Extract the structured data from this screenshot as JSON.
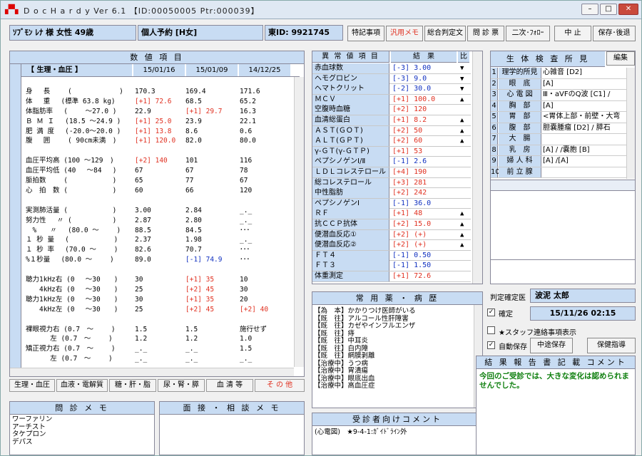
{
  "window": {
    "title": "D o c H a r d y  Ver 6.1  【ID:00050005 Ptr:000039】",
    "min": "–",
    "max": "□",
    "close": "✕"
  },
  "header": {
    "patient": "ｿﾌﾞﾓﾝ ﾚﾅ 様  女性  49歳",
    "reservation": "個人予約 [H女]",
    "id": "東ID: 9921745"
  },
  "toolbar": {
    "special": "特記事項",
    "memo": "汎用メモ",
    "summary": "総合判定文",
    "questionnaire": "問 診 票",
    "followup": "二次･ﾌｫﾛｰ",
    "stop": "中 止",
    "save_back": "保存･後退"
  },
  "values": {
    "title": "数 値 項 目",
    "group": "【 生理・血圧 】",
    "dates": [
      "15/01/16",
      "15/01/09",
      "14/12/25"
    ],
    "rows": [
      {
        "label": "",
        "c1": "",
        "c2": "",
        "c3": ""
      },
      {
        "label": "身　 長　　 (　　　　　　　)",
        "c1": "170.3",
        "c2": "169.4",
        "c3": "171.6"
      },
      {
        "label": "体　 重　 (標準 63.8 kg)",
        "c1": "[+1] 72.6",
        "c1c": "red",
        "c2": "68.5",
        "c3": "65.2"
      },
      {
        "label": "体脂肪率　 (　　 ～27.0 )",
        "c1": "22.9",
        "c2": "[+1] 29.7",
        "c2c": "red",
        "c3": "16.3"
      },
      {
        "label": "Ｂ Ｍ Ｉ　 (18.5 ～24.9 )",
        "c1": "[+1] 25.0",
        "c1c": "red",
        "c2": "23.9",
        "c3": "22.1"
      },
      {
        "label": "肥 満 度　 (-20.0～20.0 )",
        "c1": "[+1] 13.8",
        "c1c": "red",
        "c2": "8.6",
        "c3": "0.6"
      },
      {
        "label": "腹　 囲　　 ( 90cm未満　)",
        "c1": "[+1] 120.0",
        "c1c": "red",
        "c2": "82.0",
        "c3": "80.0"
      },
      {
        "label": "",
        "c1": "",
        "c2": "",
        "c3": ""
      },
      {
        "label": "血圧平均高 (100 ～129　)",
        "c1": "[+2] 140",
        "c1c": "red",
        "c2": "101",
        "c3": "116"
      },
      {
        "label": "血圧平均低 (40　 ～84　 )",
        "c1": "67",
        "c2": "67",
        "c3": "78"
      },
      {
        "label": "脈拍数　　 (　　　　　　 )",
        "c1": "65",
        "c2": "77",
        "c3": "67"
      },
      {
        "label": "心　拍　数 (　　　　　　 )",
        "c1": "60",
        "c2": "66",
        "c3": "120"
      },
      {
        "label": "",
        "c1": "",
        "c2": "",
        "c3": ""
      },
      {
        "label": "実測肺活量 (　　　　　　 )",
        "c1": "3.00",
        "c2": "2.84",
        "c3": "_._"
      },
      {
        "label": "努力性　 〃 (　　　　　　)",
        "c1": "2.87",
        "c2": "2.80",
        "c3": "_._"
      },
      {
        "label": "　%　　〃　 (80.0 ～　　 )",
        "c1": "88.5",
        "c2": "84.5",
        "c3": "･･･"
      },
      {
        "label": "１ 秒 量　 (　　　　　　 )",
        "c1": "2.37",
        "c2": "1.98",
        "c3": "_._"
      },
      {
        "label": "１ 秒 率　 (70.0 ～　　 )",
        "c1": "82.6",
        "c2": "70.7",
        "c3": "･･･"
      },
      {
        "label": "%１秒量　 (80.0 ～　　 )",
        "c1": "89.0",
        "c2": "[-1] 74.9",
        "c2c": "blue",
        "c3": "･･･"
      },
      {
        "label": "",
        "c1": "",
        "c2": "",
        "c3": ""
      },
      {
        "label": "聴力1kHz右 (0　 ～30　　)",
        "c1": "30",
        "c2": "[+1] 35",
        "c2c": "red",
        "c3": "10"
      },
      {
        "label": "　　4kHz右 (0　 ～30　　)",
        "c1": "25",
        "c2": "[+2] 45",
        "c2c": "red",
        "c3": "30"
      },
      {
        "label": "聴力1kHz左 (0　 ～30　　)",
        "c1": "30",
        "c2": "[+1] 35",
        "c2c": "red",
        "c3": "20"
      },
      {
        "label": "　　4kHz左 (0　 ～30　　)",
        "c1": "25",
        "c2": "[+2] 45",
        "c2c": "red",
        "c3": "[+2] 40",
        "c3c": "red"
      },
      {
        "label": "",
        "c1": "",
        "c2": "",
        "c3": ""
      },
      {
        "label": "裸眼視力右 (0.7　～　　 )",
        "c1": "1.5",
        "c2": "1.5",
        "c3": "施行せず"
      },
      {
        "label": "　　　 左 (0.7　～　　 )",
        "c1": "1.2",
        "c2": "1.2",
        "c3": "1.0"
      },
      {
        "label": "矯正視力右 (0.7　～　　 )",
        "c1": "_._",
        "c2": "_._",
        "c3": "1.5"
      },
      {
        "label": "　　　 左 (0.7　～　　 )",
        "c1": "_._",
        "c2": "_._",
        "c3": "_._"
      }
    ]
  },
  "tabs": [
    "生理・血圧",
    "血液・電解質",
    "糖・肝・脂",
    "尿・腎・膵",
    "血 清 等",
    "そ の 他"
  ],
  "abnormal": {
    "title": "異 常 値 項 目",
    "result_header": "結　果",
    "ratio_header": "比",
    "rows": [
      {
        "name": "赤血球数",
        "value": "[-3] 3.00",
        "vc": "blue",
        "flag": "▼"
      },
      {
        "name": "ヘモグロビン",
        "value": "[-3] 9.0",
        "vc": "blue",
        "flag": "▼"
      },
      {
        "name": "ヘマトクリット",
        "value": "[-2] 30.0",
        "vc": "blue",
        "flag": "▼"
      },
      {
        "name": "ＭＣＶ",
        "value": "[+1] 100.0",
        "vc": "red",
        "flag": "▲"
      },
      {
        "name": "空腹時血糖",
        "value": "[+2] 120",
        "vc": "red",
        "flag": ""
      },
      {
        "name": "血清総蛋白",
        "value": "[+1] 8.2",
        "vc": "red",
        "flag": "▲"
      },
      {
        "name": "ＡＳＴ(ＧＯＴ)",
        "value": "[+2] 50",
        "vc": "red",
        "flag": "▲"
      },
      {
        "name": "ＡＬＴ(ＧＰＴ)",
        "value": "[+2] 60",
        "vc": "red",
        "flag": "▲"
      },
      {
        "name": "γ-ＧＴ(γ-ＧＴＰ)",
        "value": "[+1] 53",
        "vc": "red",
        "flag": ""
      },
      {
        "name": "ペプシノゲンⅠ/Ⅱ",
        "value": "[-1] 2.6",
        "vc": "blue",
        "flag": ""
      },
      {
        "name": "ＬＤＬコレステロール",
        "value": "[+4] 190",
        "vc": "red",
        "flag": ""
      },
      {
        "name": "総コレステロール",
        "value": "[+3] 281",
        "vc": "red",
        "flag": ""
      },
      {
        "name": "中性脂肪",
        "value": "[+2] 242",
        "vc": "red",
        "flag": ""
      },
      {
        "name": "ペプシノゲンⅠ",
        "value": "[-1] 36.0",
        "vc": "blue",
        "flag": ""
      },
      {
        "name": "ＲＦ",
        "value": "[+1] 48",
        "vc": "red",
        "flag": "▲"
      },
      {
        "name": "抗ＣＣＰ抗体",
        "value": "[+2] 15.0",
        "vc": "red",
        "flag": "▲"
      },
      {
        "name": "便潜血反応①",
        "value": "[+2] (+)",
        "vc": "red",
        "flag": "▲"
      },
      {
        "name": "便潜血反応②",
        "value": "[+2] (+)",
        "vc": "red",
        "flag": "▲"
      },
      {
        "name": "ＦＴ４",
        "value": "[-1] 0.50",
        "vc": "blue",
        "flag": ""
      },
      {
        "name": "ＦＴ３",
        "value": "[-1] 1.50",
        "vc": "blue",
        "flag": ""
      },
      {
        "name": "体重測定",
        "value": "[+1] 72.6",
        "vc": "red",
        "flag": ""
      }
    ]
  },
  "findings": {
    "title": "生 体 検 査 所 見",
    "edit": "編集",
    "rows": [
      {
        "no": "1",
        "name": "理学的所見",
        "value": "心雑音 [D2]"
      },
      {
        "no": "2",
        "name": "眼　底",
        "value": "[A]"
      },
      {
        "no": "3",
        "name": "心 電 図",
        "value": "Ⅲ・aVFのQ波 [C1] /"
      },
      {
        "no": "4",
        "name": "胸　部",
        "value": "[A]"
      },
      {
        "no": "5",
        "name": "胃　部",
        "value": "<胃体上部・前壁・大弯"
      },
      {
        "no": "6",
        "name": "腹　部",
        "value": "胆嚢腫瘤 [D2] / 膵石"
      },
      {
        "no": "7",
        "name": "大　腸",
        "value": ""
      },
      {
        "no": "8",
        "name": "乳　房",
        "value": "[A] / /嚢胞 [B]"
      },
      {
        "no": "9",
        "name": "婦 人 科",
        "value": "[A] /[A]"
      },
      {
        "no": "10",
        "name": "前 立 腺",
        "value": ""
      }
    ]
  },
  "meds": {
    "title": "常 用 薬 ・ 病 歴",
    "lines": [
      "【為　本】かかりつけ医師がいる",
      "【既　往】アルコール性肝障害",
      "【既　往】カゼやインフルエンザ",
      "【既　往】痔",
      "【既　往】中耳炎",
      "【既　往】白内障",
      "【既　往】網膜剥離",
      "【治療中】うつ病",
      "【治療中】胃潰瘍",
      "【治療中】眼底出血",
      "【治療中】高血圧症"
    ]
  },
  "judge": {
    "doctor_label": "判定確定医",
    "doctor": "波泥 太郎",
    "confirm_label": "確定",
    "confirm_checked": "✓",
    "datetime": "15/11/26 02:15",
    "staff_label": "★スタッフ連絡事項表示",
    "autosave_label": "自動保存",
    "autosave_checked": "✓",
    "interim_save": "中途保存",
    "health_guide": "保健指導"
  },
  "report": {
    "title": "結 果 報 告 書 記 載 コメント",
    "text": "今回のご受診では、大きな変化は認められませんでした。"
  },
  "interview_memo": {
    "title": "問 診 メ モ",
    "lines": [
      "ワーファリン",
      "アーチスト",
      "タケプロン",
      "デパス"
    ]
  },
  "consult_memo": {
    "title": "面 接 ・ 相 談 メ モ"
  },
  "patient_comment": {
    "title": "受診者向けコメント",
    "text": "(心電図)　★9-4-1:ｶﾞｲﾄﾞﾗｲﾝ外"
  }
}
